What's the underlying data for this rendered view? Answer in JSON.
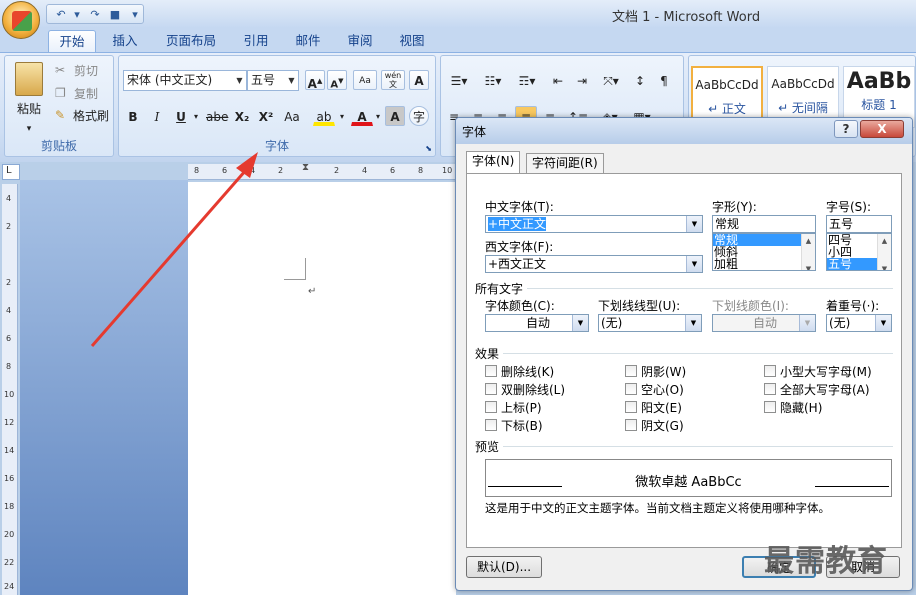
{
  "window": {
    "title": "文档 1 - Microsoft Word"
  },
  "tabs": [
    "开始",
    "插入",
    "页面布局",
    "引用",
    "邮件",
    "审阅",
    "视图"
  ],
  "clipboard": {
    "paste": "粘贴",
    "cut": "剪切",
    "copy": "复制",
    "format_painter": "格式刷",
    "label": "剪贴板"
  },
  "font_group": {
    "font_name": "宋体 (中文正文)",
    "font_size": "五号",
    "label": "字体",
    "wen": "wén",
    "wen2": "文",
    "A": "A",
    "bold": "B",
    "italic": "I",
    "underline": "U",
    "strike": "abe",
    "sub": "X₂",
    "sup": "X²",
    "aa": "Aa"
  },
  "styles": [
    {
      "sample": "AaBbCcDd",
      "name": "↵ 正文"
    },
    {
      "sample": "AaBbCcDd",
      "name": "↵ 无间隔"
    },
    {
      "sample": "AaBb",
      "name": "标题 1"
    }
  ],
  "ruler": {
    "h_marks": [
      "8",
      "6",
      "4",
      "2",
      "2",
      "4",
      "6",
      "8",
      "10"
    ],
    "v_marks": [
      "4",
      "2",
      "2",
      "4",
      "6",
      "8",
      "10",
      "12",
      "14",
      "16",
      "18",
      "20",
      "22",
      "24"
    ]
  },
  "doc": {
    "para_mark": "↵"
  },
  "dialog": {
    "title": "字体",
    "help": "?",
    "close": "X",
    "tabs": [
      "字体(N)",
      "字符间距(R)"
    ],
    "cn_font_label": "中文字体(T):",
    "cn_font_value": "+中文正文",
    "style_label": "字形(Y):",
    "style_value": "常规",
    "style_options": [
      "常规",
      "倾斜",
      "加粗"
    ],
    "size_label": "字号(S):",
    "size_value": "五号",
    "size_options": [
      "四号",
      "小四",
      "五号"
    ],
    "west_font_label": "西文字体(F):",
    "west_font_value": "+西文正文",
    "all_text": "所有文字",
    "color_label": "字体颜色(C):",
    "color_value": "自动",
    "underline_label": "下划线线型(U):",
    "underline_value": "(无)",
    "underline_color_label": "下划线颜色(I):",
    "underline_color_value": "自动",
    "emphasis_label": "着重号(·):",
    "emphasis_value": "(无)",
    "effects_label": "效果",
    "effects": [
      "删除线(K)",
      "双删除线(L)",
      "上标(P)",
      "下标(B)",
      "阴影(W)",
      "空心(O)",
      "阳文(E)",
      "阴文(G)",
      "小型大写字母(M)",
      "全部大写字母(A)",
      "隐藏(H)"
    ],
    "preview_label": "预览",
    "preview_text": "微软卓越 AaBbCc",
    "desc": "这是用于中文的正文主题字体。当前文档主题定义将使用哪种字体。",
    "default_btn": "默认(D)...",
    "ok_btn": "确定",
    "cancel_btn": "取消"
  },
  "watermark": "最需教育",
  "colors": {
    "ribbon": "#cfdff4",
    "accent": "#15428b",
    "arrow": "#e53a2f",
    "selection": "#3399ff"
  }
}
